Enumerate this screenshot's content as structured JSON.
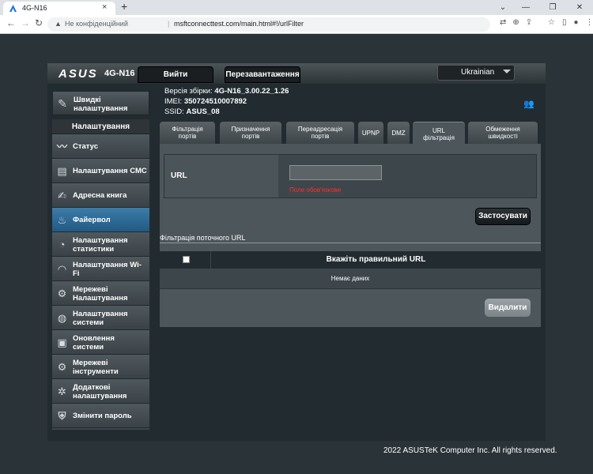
{
  "browser": {
    "tab_title": "4G-N16",
    "tab_close": "×",
    "new_tab": "+",
    "address": {
      "insecure_label": "Не конфіденційний",
      "separator": "|",
      "url": "msftconnecttest.com/main.html#!/urlFilter"
    },
    "icons": [
      "back-icon",
      "forward-icon",
      "reload-icon",
      "warning-icon",
      "translate-icon",
      "zoom-icon",
      "share-icon",
      "star-icon",
      "sidebar-icon",
      "profile-icon",
      "menu-icon"
    ]
  },
  "router": {
    "logo": "ASUS",
    "model": "4G-N16",
    "logout_label": "Вийти",
    "reboot_label": "Перезавантаження",
    "language": "Ukrainian",
    "info": {
      "firmware_label": "Версія збірки:",
      "firmware_value": "4G-N16_3.00.22_1.26",
      "imei_label": "IMEI:",
      "imei_value": "350724510007892",
      "ssid_label": "SSID:",
      "ssid_value": "ASUS_08"
    },
    "quick_setup": {
      "line1": "Швидкі",
      "line2": "налаштування"
    },
    "sidebar": {
      "heading": "Налаштування",
      "items": [
        {
          "line1": "Статус",
          "line2": ""
        },
        {
          "line1": "Налаштування СМС",
          "line2": ""
        },
        {
          "line1": "Адресна книга",
          "line2": ""
        },
        {
          "line1": "Файервол",
          "line2": ""
        },
        {
          "line1": "Налаштування",
          "line2": "статистики"
        },
        {
          "line1": "Налаштування Wi-",
          "line2": "Fi"
        },
        {
          "line1": "Мережеві",
          "line2": "Налаштування"
        },
        {
          "line1": "Налаштування",
          "line2": "системи"
        },
        {
          "line1": "Оновлення",
          "line2": "системи"
        },
        {
          "line1": "Мережеві",
          "line2": "інструменти"
        },
        {
          "line1": "Додаткові",
          "line2": "налаштування"
        },
        {
          "line1": "Змінити пароль",
          "line2": ""
        }
      ]
    },
    "tabs": [
      {
        "line1": "Фільтрація",
        "line2": "портів"
      },
      {
        "line1": "Призначення",
        "line2": "портів"
      },
      {
        "line1": "Переадресація",
        "line2": "портів"
      },
      {
        "line1": "UPNP",
        "line2": ""
      },
      {
        "line1": "DMZ",
        "line2": ""
      },
      {
        "line1": "URL",
        "line2": "фільтрація"
      },
      {
        "line1": "Обмеження",
        "line2": "швидкості"
      }
    ],
    "url_filter": {
      "url_label": "URL",
      "url_value": "",
      "url_hint": "Поле обов'язкове",
      "apply_label": "Застосувати",
      "list_caption": "Фільтрація поточного URL",
      "column_header": "Вкажіть правильний URL",
      "empty_text": "Немає даних",
      "delete_label": "Видалити"
    },
    "copyright": "2022 ASUSTeK Computer Inc. All rights reserved."
  }
}
